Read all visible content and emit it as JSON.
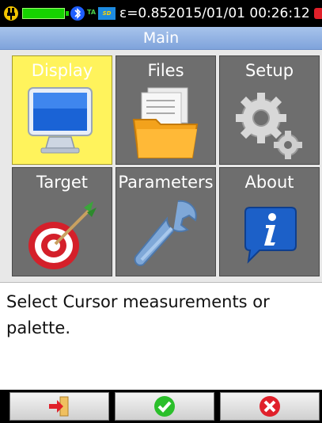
{
  "status": {
    "emissivity": "ε=0.85",
    "datetime": "2015/01/01 00:26:12",
    "ta_label": "TA",
    "sd_label": "SD"
  },
  "window": {
    "title": "Main"
  },
  "menu": {
    "tiles": [
      {
        "label": "Display",
        "icon": "monitor-icon",
        "selected": true
      },
      {
        "label": "Files",
        "icon": "folder-icon",
        "selected": false
      },
      {
        "label": "Setup",
        "icon": "gears-icon",
        "selected": false
      },
      {
        "label": "Target",
        "icon": "target-icon",
        "selected": false
      },
      {
        "label": "Parameters",
        "icon": "wrench-icon",
        "selected": false
      },
      {
        "label": "About",
        "icon": "info-icon",
        "selected": false
      }
    ]
  },
  "description": "Select Cursor measurements or palette.",
  "softkeys": [
    {
      "icon": "exit-icon"
    },
    {
      "icon": "confirm-check-icon"
    },
    {
      "icon": "cancel-x-icon"
    }
  ],
  "colors": {
    "title_bar": "#8fb0e2",
    "selected_tile": "#fff35c",
    "tile": "#6e6e6e",
    "battery": "#16d400",
    "confirm": "#2bbf2b",
    "cancel": "#e0202a"
  }
}
